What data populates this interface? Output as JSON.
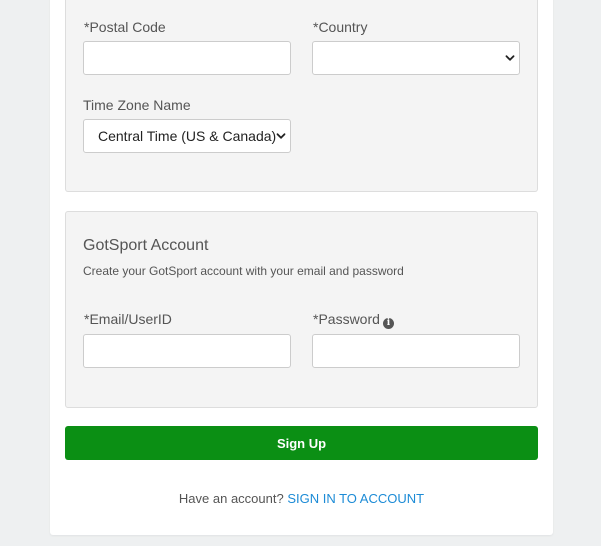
{
  "address": {
    "postal_code_label": "*Postal Code",
    "postal_code_value": "",
    "country_label": "*Country",
    "country_value": "",
    "time_zone_label": "Time Zone Name",
    "time_zone_value": "Central Time (US & Canada)"
  },
  "account": {
    "heading": "GotSport Account",
    "description": "Create your GotSport account with your email and password",
    "email_label": "*Email/UserID",
    "email_value": "",
    "password_label": "*Password",
    "password_value": "",
    "password_info_icon": "info-circle-icon"
  },
  "actions": {
    "sign_up_label": "Sign Up",
    "have_account_text": "Have an account?",
    "sign_in_link": "SIGN IN TO ACCOUNT"
  },
  "colors": {
    "primary_button": "#0b8f14",
    "link": "#1c8bd6",
    "panel_background": "#f4f4f4",
    "page_background": "#eef0f1"
  }
}
